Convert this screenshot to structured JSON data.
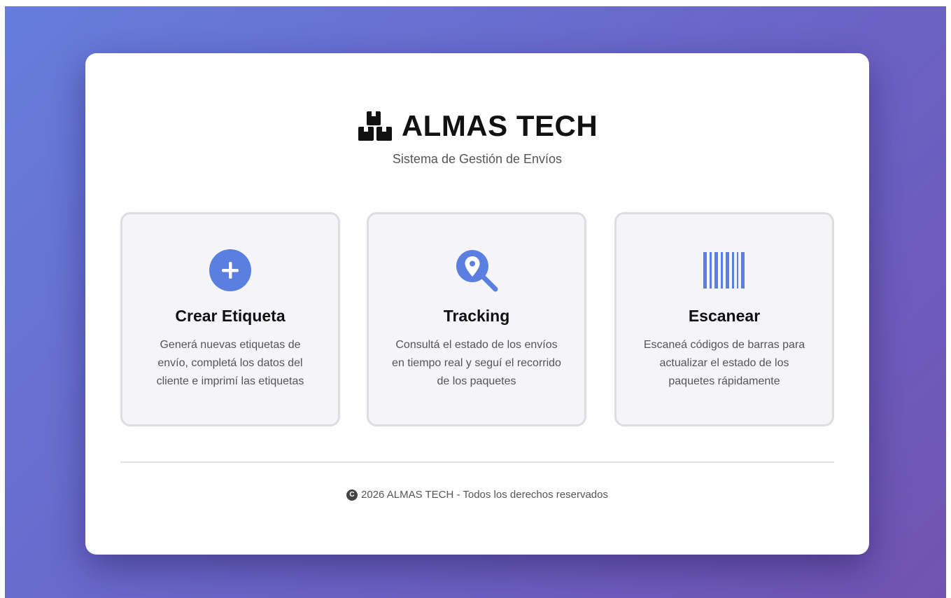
{
  "brand": {
    "title": "ALMAS TECH",
    "subtitle": "Sistema de Gestión de Envíos",
    "icon": "boxes-icon"
  },
  "features": [
    {
      "title": "Crear Etiqueta",
      "description": "Generá nuevas etiquetas de envío, completá los datos del cliente e imprimí las etiquetas",
      "icon": "plus-circle-icon"
    },
    {
      "title": "Tracking",
      "description": "Consultá el estado de los envíos en tiempo real y seguí el recorrido de los paquetes",
      "icon": "search-location-icon"
    },
    {
      "title": "Escanear",
      "description": "Escaneá códigos de barras para actualizar el estado de los paquetes rápidamente",
      "icon": "barcode-icon"
    }
  ],
  "footer": {
    "text": "2026 ALMAS TECH - Todos los derechos reservados",
    "icon": "copyright-icon"
  },
  "colors": {
    "accent": "#5b7fe0",
    "background_start": "#667ddd",
    "background_end": "#7153b2",
    "card_bg": "#ffffff",
    "feature_bg": "#f5f5f9",
    "feature_border": "#dedee2"
  }
}
